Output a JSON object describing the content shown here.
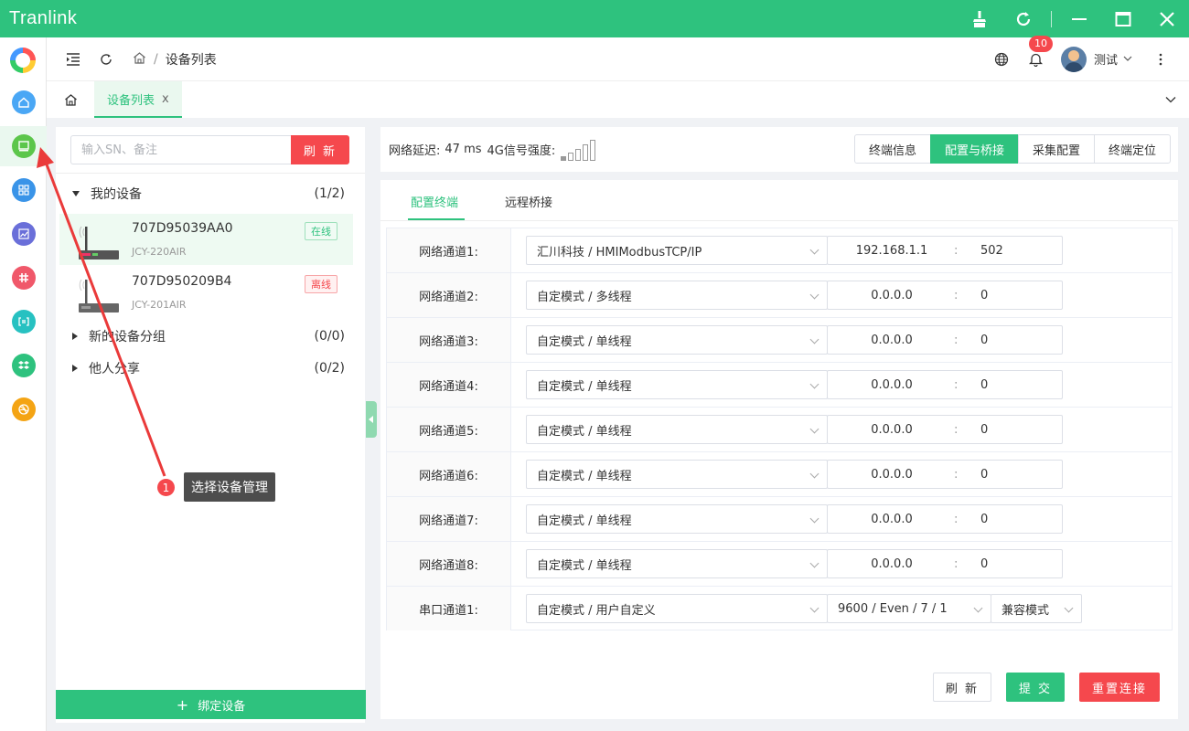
{
  "app": {
    "title": "Tranlink"
  },
  "window_controls": [
    "broom-icon",
    "refresh-icon",
    "minimize-icon",
    "maximize-icon",
    "close-icon"
  ],
  "rail": {
    "items": [
      {
        "name": "home",
        "icon": "home-icon",
        "color": "#4aa7f5"
      },
      {
        "name": "device-manage",
        "icon": "monitor-icon",
        "color": "#5cc64b"
      },
      {
        "name": "apps",
        "icon": "grid-icon",
        "color": "#3a94e8"
      },
      {
        "name": "chart",
        "icon": "chart-icon",
        "color": "#6a6fd9"
      },
      {
        "name": "slack",
        "icon": "hash-icon",
        "color": "#f0586a"
      },
      {
        "name": "kbd",
        "icon": "bracket-icon",
        "color": "#27c1c1"
      },
      {
        "name": "dropbox",
        "icon": "box-icon",
        "color": "#2ec27e"
      },
      {
        "name": "dribbble",
        "icon": "ball-icon",
        "color": "#f4a414"
      }
    ]
  },
  "header": {
    "breadcrumb": "设备列表",
    "notification_count": "10",
    "user_name": "测试"
  },
  "tabs": {
    "active_label": "设备列表",
    "close_label": "x"
  },
  "devices": {
    "search_placeholder": "输入SN、备注",
    "refresh_label": "刷 新",
    "groups": [
      {
        "label": "我的设备",
        "count": "(1/2)"
      },
      {
        "label": "新的设备分组",
        "count": "(0/0)"
      },
      {
        "label": "他人分享",
        "count": "(0/2)"
      }
    ],
    "items": [
      {
        "sn": "707D95039AA0",
        "model": "JCY-220AIR",
        "status": "在线"
      },
      {
        "sn": "707D950209B4",
        "model": "JCY-201AIR",
        "status": "离线"
      }
    ],
    "bind_label": "绑定设备"
  },
  "info": {
    "latency_label": "网络延迟:",
    "latency_value": "47 ms",
    "signal_label": "4G信号强度:",
    "signal_level": 0.25,
    "tabs": [
      "终端信息",
      "配置与桥接",
      "采集配置",
      "终端定位"
    ],
    "active_tab": "配置与桥接"
  },
  "config": {
    "subtabs": [
      "配置终端",
      "远程桥接"
    ],
    "channels": [
      {
        "label": "网络通道1:",
        "mode": "汇川科技 / HMIModbusTCP/IP",
        "ip": "192.168.1.1",
        "port": "502"
      },
      {
        "label": "网络通道2:",
        "mode": "自定模式 / 多线程",
        "ip": "0.0.0.0",
        "port": "0"
      },
      {
        "label": "网络通道3:",
        "mode": "自定模式 / 单线程",
        "ip": "0.0.0.0",
        "port": "0"
      },
      {
        "label": "网络通道4:",
        "mode": "自定模式 / 单线程",
        "ip": "0.0.0.0",
        "port": "0"
      },
      {
        "label": "网络通道5:",
        "mode": "自定模式 / 单线程",
        "ip": "0.0.0.0",
        "port": "0"
      },
      {
        "label": "网络通道6:",
        "mode": "自定模式 / 单线程",
        "ip": "0.0.0.0",
        "port": "0"
      },
      {
        "label": "网络通道7:",
        "mode": "自定模式 / 单线程",
        "ip": "0.0.0.0",
        "port": "0"
      },
      {
        "label": "网络通道8:",
        "mode": "自定模式 / 单线程",
        "ip": "0.0.0.0",
        "port": "0"
      }
    ],
    "serial": {
      "label": "串口通道1:",
      "mode": "自定模式 / 用户自定义",
      "params": "9600 / Even / 7 / 1",
      "compat": "兼容模式"
    },
    "colon": ":",
    "buttons": {
      "refresh": "刷 新",
      "submit": "提 交",
      "reset": "重置连接"
    }
  },
  "annotation": {
    "number": "1",
    "text": "选择设备管理"
  },
  "colors": {
    "primary": "#2ec27e",
    "danger": "#f5484d",
    "annotation": "#ea3a3a"
  }
}
